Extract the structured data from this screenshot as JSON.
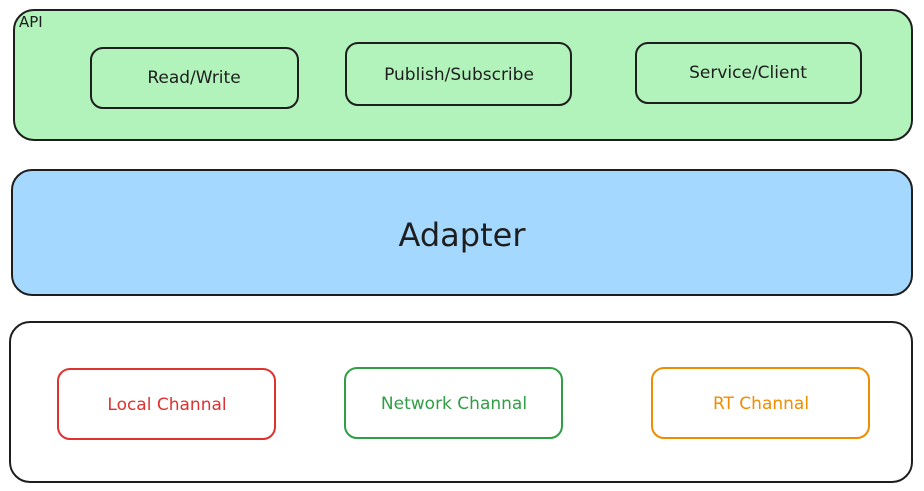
{
  "api_layer": {
    "label": "API",
    "fill": "#b2f2bb",
    "stroke": "#1e1e1e",
    "boxes": [
      {
        "label": "Read/Write"
      },
      {
        "label": "Publish/Subscribe"
      },
      {
        "label": "Service/Client"
      }
    ]
  },
  "adapter_layer": {
    "label": "Adapter",
    "fill": "#a5d8ff",
    "stroke": "#1e1e1e"
  },
  "channel_layer": {
    "fill": "#ffffff",
    "stroke": "#1e1e1e",
    "channels": [
      {
        "label": "Local Channal",
        "color": "#e03131"
      },
      {
        "label": "Network Channal",
        "color": "#2f9e44"
      },
      {
        "label": "RT Channal",
        "color": "#f08c00"
      }
    ]
  }
}
